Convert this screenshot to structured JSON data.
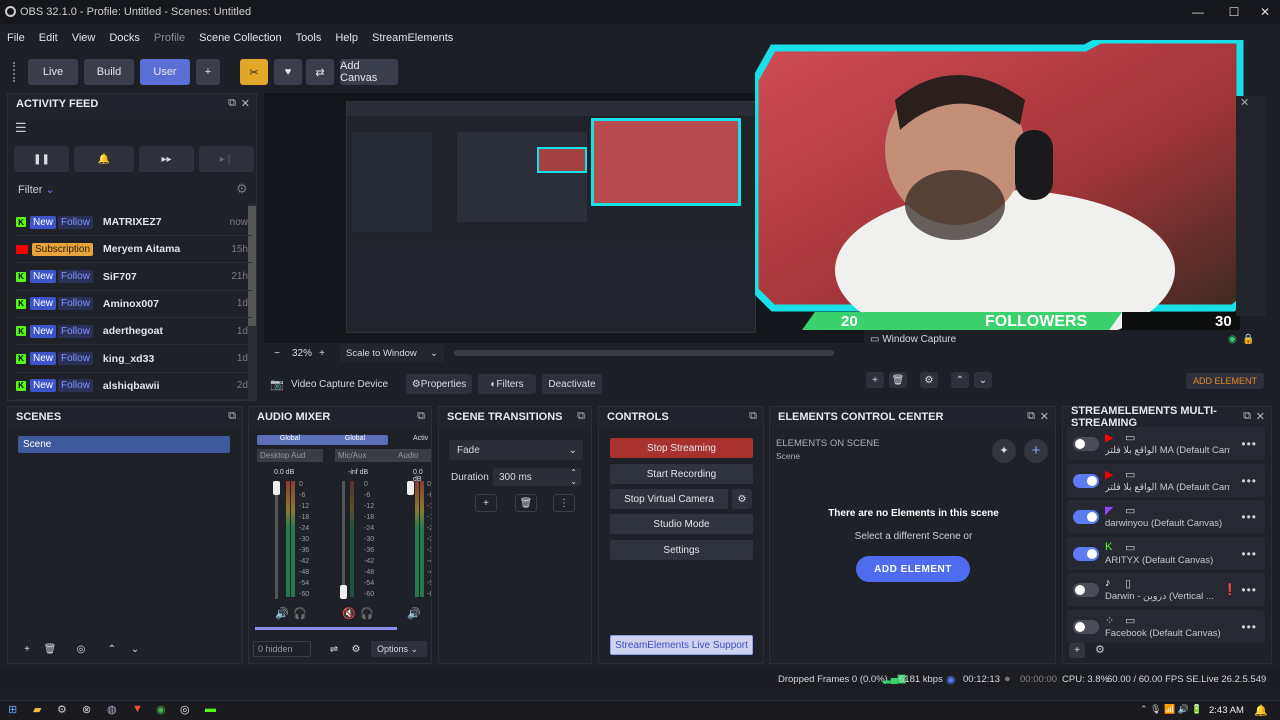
{
  "window": {
    "title": "OBS 32.1.0 - Profile: Untitled - Scenes: Untitled",
    "minimize": "—",
    "maximize": "☐",
    "close": "✕"
  },
  "menu": [
    "File",
    "Edit",
    "View",
    "Docks",
    "Profile",
    "Scene Collection",
    "Tools",
    "Help",
    "StreamElements"
  ],
  "toolbar": {
    "live": "Live",
    "build": "Build",
    "user": "User",
    "plus": "+",
    "add_canvas": "Add Canvas"
  },
  "activity": {
    "title": "ACTIVITY FEED",
    "filter": "Filter",
    "items": [
      {
        "platform": "kick",
        "badge1": "New",
        "badge2": "Follow",
        "name": "MATRIXEZ7",
        "time": "now"
      },
      {
        "platform": "youtube",
        "badge1": "Subscription",
        "badge2": "",
        "name": "Meryem Aitama",
        "time": "15h"
      },
      {
        "platform": "kick",
        "badge1": "New",
        "badge2": "Follow",
        "name": "SiF707",
        "time": "21h"
      },
      {
        "platform": "kick",
        "badge1": "New",
        "badge2": "Follow",
        "name": "Aminox007",
        "time": "1d"
      },
      {
        "platform": "kick",
        "badge1": "New",
        "badge2": "Follow",
        "name": "aderthegoat",
        "time": "1d"
      },
      {
        "platform": "kick",
        "badge1": "New",
        "badge2": "Follow",
        "name": "king_xd33",
        "time": "1d"
      },
      {
        "platform": "kick",
        "badge1": "New",
        "badge2": "Follow",
        "name": "alshiqbawii",
        "time": "2d"
      }
    ]
  },
  "preview": {
    "zoom": "32%",
    "minus": "−",
    "plus": "+",
    "scale": "Scale to Window",
    "source_label": "Video Capture Device",
    "properties": "Properties",
    "filters": "Filters",
    "deactivate": "Deactivate"
  },
  "overlay": {
    "left_num": "20",
    "label": "FOLLOWERS",
    "right_num": "30"
  },
  "sources": {
    "window_capture": "Window Capture",
    "add_element": "ADD ELEMENT"
  },
  "scenes": {
    "title": "SCENES",
    "items": [
      "Scene"
    ]
  },
  "mixer": {
    "title": "AUDIO MIXER",
    "ch1_tag": "Global",
    "ch1_name": "Desktop Aud",
    "ch1_db": "0.0 dB",
    "ch2_tag": "Global",
    "ch2_name": "Mic/Aux",
    "ch2_db": "-inf dB",
    "ch3_tag": "Activ",
    "ch3_name": "Audio",
    "ch3_db": "0.0 dB",
    "scale": [
      "0",
      "-6",
      "-12",
      "-18",
      "-24",
      "-30",
      "-36",
      "-42",
      "-48",
      "-54",
      "-60"
    ],
    "hidden": "0 hidden",
    "options": "Options"
  },
  "transitions": {
    "title": "SCENE TRANSITIONS",
    "value": "Fade",
    "duration_label": "Duration",
    "duration": "300 ms"
  },
  "controls": {
    "title": "CONTROLS",
    "stop_streaming": "Stop Streaming",
    "start_recording": "Start Recording",
    "stop_virtual": "Stop Virtual Camera",
    "studio": "Studio Mode",
    "settings": "Settings",
    "support": "StreamElements Live Support"
  },
  "elements": {
    "title": "ELEMENTS CONTROL CENTER",
    "heading": "ELEMENTS ON SCENE",
    "scene": "Scene",
    "empty": "There are no Elements in this scene",
    "hint": "Select a different Scene or",
    "add": "ADD ELEMENT"
  },
  "multistream": {
    "title": "STREAMELEMENTS MULTI-STREAMING",
    "items": [
      {
        "name": "الواقع بلا فلتر MA (Default Canvas)",
        "on": false,
        "platform": "youtube"
      },
      {
        "name": "الواقع بلا فلتر MA (Default Canvas)",
        "on": true,
        "platform": "youtube"
      },
      {
        "name": "darwinyou (Default Canvas)",
        "on": true,
        "platform": "twitch"
      },
      {
        "name": "ARITYX (Default Canvas)",
        "on": true,
        "platform": "kick"
      },
      {
        "name": "Darwin - دروين (Vertical ...",
        "on": false,
        "platform": "tiktok"
      },
      {
        "name": "Facebook (Default Canvas)",
        "on": false,
        "platform": "facebook"
      }
    ]
  },
  "status": {
    "dropped": "Dropped Frames 0 (0.0%)",
    "kbps": "6181 kbps",
    "stream_time": "00:12:13",
    "rec_time": "00:00:00",
    "cpu": "CPU: 3.8%",
    "fps": "60.00 / 60.00 FPS",
    "version": "SE.Live 26.2.5.549"
  },
  "taskbar": {
    "time": "2:43 AM"
  },
  "colors": {
    "accent": "#5b7cf5",
    "stop": "#a8322f",
    "neon": "#17e0e8",
    "follower_green": "#3bd16f"
  }
}
